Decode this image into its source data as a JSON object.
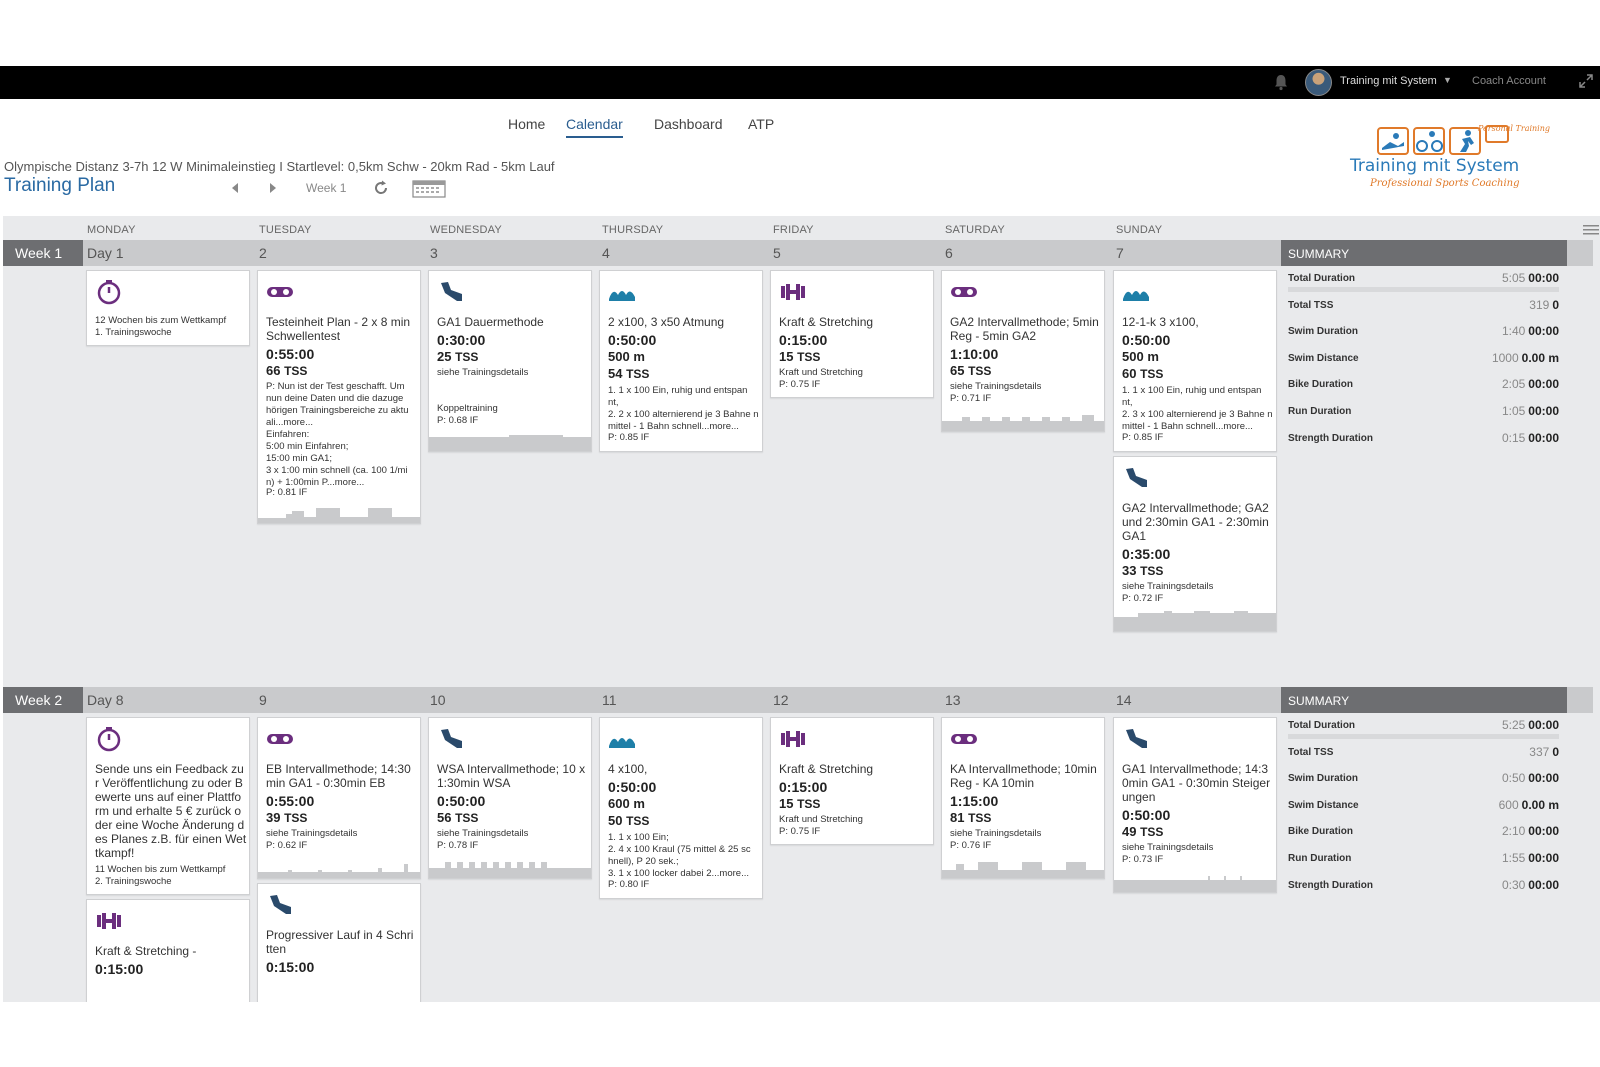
{
  "topbar": {
    "user_name": "Training mit System",
    "coach_label": "Coach Account"
  },
  "nav": {
    "items": [
      "Home",
      "Calendar",
      "Dashboard",
      "ATP"
    ],
    "active": "Calendar"
  },
  "plan": {
    "subtitle": "Olympische Distanz 3-7h 12 W Minimaleinstieg I Startlevel: 0,5km Schw - 20km Rad - 5km Lauf",
    "title": "Training Plan",
    "week_label": "Week 1"
  },
  "logo": {
    "line1": "Training mit System",
    "line2": "Professional Sports Coaching",
    "badge": "Personal Training"
  },
  "days": [
    "MONDAY",
    "TUESDAY",
    "WEDNESDAY",
    "THURSDAY",
    "FRIDAY",
    "SATURDAY",
    "SUNDAY"
  ],
  "colors": {
    "purple": "#6b2e7e",
    "blue": "#1e7fa8",
    "navy": "#2a4a6b",
    "header_grey": "#6d6e71"
  },
  "weeks": [
    {
      "label": "Week 1",
      "day_labels": [
        "Day 1",
        "2",
        "3",
        "4",
        "5",
        "6",
        "7"
      ],
      "summary": {
        "title": "SUMMARY",
        "rows": [
          {
            "label": "Total Duration",
            "muted": "5:05",
            "value": "00:00"
          },
          {
            "label": "Total TSS",
            "muted": "319",
            "value": "0"
          },
          {
            "label": "Swim Duration",
            "muted": "1:40",
            "value": "00:00"
          },
          {
            "label": "Swim Distance",
            "muted": "1000",
            "value": "0.00 m"
          },
          {
            "label": "Bike Duration",
            "muted": "2:05",
            "value": "00:00"
          },
          {
            "label": "Run Duration",
            "muted": "1:05",
            "value": "00:00"
          },
          {
            "label": "Strength Duration",
            "muted": "0:15",
            "value": "00:00"
          }
        ]
      },
      "cards": {
        "mon": {
          "icon": "stopwatch-icon",
          "note": "12 Wochen bis zum Wettkampf\n1. Trainingswoche"
        },
        "tue": {
          "icon": "bike-icon",
          "title": "Testeinheit Plan - 2 x 8 min Schwellentest",
          "duration": "0:55:00",
          "tss": "66",
          "desc": "P: Nun ist der Test geschafft. Um nun deine Daten und die dazuge hörigen Trainingsbereiche zu aktu ali...more...\nEinfahren:\n5:00 min Einfahren;\n15:00 min GA1;\n3 x 1:00 min schnell (ca. 100 1/mi n) + 1:00min P...more...",
          "if": "P: 0.81 IF"
        },
        "wed": {
          "icon": "run-icon",
          "title": "GA1 Dauermethode",
          "duration": "0:30:00",
          "tss": "25",
          "desc": "siehe Trainingsdetails\n\n\nKoppeltraining",
          "if": "P: 0.68 IF"
        },
        "thu": {
          "icon": "swim-icon",
          "title": "2 x100, 3 x50 Atmung",
          "duration": "0:50:00",
          "distance": "500",
          "tss": "54",
          "desc": "1. 1 x 100 Ein, ruhig und entspan nt,\n2. 2 x 100 alternierend je 3 Bahne n mittel - 1 Bahn schnell...more...",
          "if": "P: 0.85 IF"
        },
        "fri": {
          "icon": "dumbbell-icon",
          "title": "Kraft & Stretching",
          "duration": "0:15:00",
          "tss": "15",
          "desc": "Kraft und Stretching",
          "if": "P: 0.75 IF"
        },
        "sat": {
          "icon": "bike-icon",
          "title": "GA2 Intervallmethode; 5min Reg - 5min GA2",
          "duration": "1:10:00",
          "tss": "65",
          "desc": "siehe Trainingsdetails",
          "if": "P: 0.71 IF"
        },
        "sun1": {
          "icon": "swim-icon",
          "title": "12-1-k 3 x100,",
          "duration": "0:50:00",
          "distance": "500",
          "tss": "60",
          "desc": "1. 1 x 100 Ein, ruhig und entspan nt,\n2. 3 x 100 alternierend je 3 Bahne n mittel - 1 Bahn schnell...more...",
          "if": "P: 0.85 IF"
        },
        "sun2": {
          "icon": "run-icon",
          "title": "GA2 Intervallmethode; GA2 und 2:30min GA1 - 2:30min GA1",
          "duration": "0:35:00",
          "tss": "33",
          "desc": "siehe Trainingsdetails",
          "if": "P: 0.72 IF"
        }
      }
    },
    {
      "label": "Week 2",
      "day_labels": [
        "Day 8",
        "9",
        "10",
        "11",
        "12",
        "13",
        "14"
      ],
      "summary": {
        "title": "SUMMARY",
        "rows": [
          {
            "label": "Total Duration",
            "muted": "5:25",
            "value": "00:00"
          },
          {
            "label": "Total TSS",
            "muted": "337",
            "value": "0"
          },
          {
            "label": "Swim Duration",
            "muted": "0:50",
            "value": "00:00"
          },
          {
            "label": "Swim Distance",
            "muted": "600",
            "value": "0.00 m"
          },
          {
            "label": "Bike Duration",
            "muted": "2:10",
            "value": "00:00"
          },
          {
            "label": "Run Duration",
            "muted": "1:55",
            "value": "00:00"
          },
          {
            "label": "Strength Duration",
            "muted": "0:30",
            "value": "00:00"
          }
        ]
      },
      "cards": {
        "mon": {
          "icon": "stopwatch-icon",
          "title": "Sende uns ein Feedback zu r Veröffentlichung zu oder B ewerte uns auf einer Plattfo rm und erhalte 5 € zurück o der eine Woche Änderung d es Planes z.B. für einen Wet tkampf!",
          "note": "11 Wochen bis zum Wettkampf\n2. Trainingswoche"
        },
        "mon2": {
          "icon": "dumbbell-icon",
          "title": "Kraft & Stretching -",
          "duration": "0:15:00"
        },
        "tue": {
          "icon": "bike-icon",
          "title": "EB Intervallmethode; 14:30 min GA1 - 0:30min EB",
          "duration": "0:55:00",
          "tss": "39",
          "desc": "siehe Trainingsdetails",
          "if": "P: 0.62 IF"
        },
        "tue2": {
          "icon": "run-icon",
          "title": "Progressiver Lauf in 4 Schri tten",
          "duration": "0:15:00"
        },
        "wed": {
          "icon": "run-icon",
          "title": "WSA Intervallmethode; 10 x 1:30min WSA",
          "duration": "0:50:00",
          "tss": "56",
          "desc": "siehe Trainingsdetails",
          "if": "P: 0.78 IF"
        },
        "thu": {
          "icon": "swim-icon",
          "title": "4 x100,",
          "duration": "0:50:00",
          "distance": "600",
          "tss": "50",
          "desc": "1. 1 x 100 Ein;\n2. 4 x 100 Kraul (75 mittel & 25 sc hnell), P 20 sek.;\n3. 1 x 100 locker dabei 2...more...",
          "if": "P: 0.80 IF"
        },
        "fri": {
          "icon": "dumbbell-icon",
          "title": "Kraft & Stretching",
          "duration": "0:15:00",
          "tss": "15",
          "desc": "Kraft und Stretching",
          "if": "P: 0.75 IF"
        },
        "sat": {
          "icon": "bike-icon",
          "title": "KA Intervallmethode; 10min Reg - KA 10min",
          "duration": "1:15:00",
          "tss": "81",
          "desc": "siehe Trainingsdetails",
          "if": "P: 0.76 IF"
        },
        "sun": {
          "icon": "run-icon",
          "title": "GA1 Intervallmethode; 14:3 0min GA1 - 0:30min Steiger ungen",
          "duration": "0:50:00",
          "tss": "49",
          "desc": "siehe Trainingsdetails",
          "if": "P: 0.73 IF"
        }
      }
    }
  ],
  "units": {
    "tss": "TSS",
    "meters": "m"
  }
}
